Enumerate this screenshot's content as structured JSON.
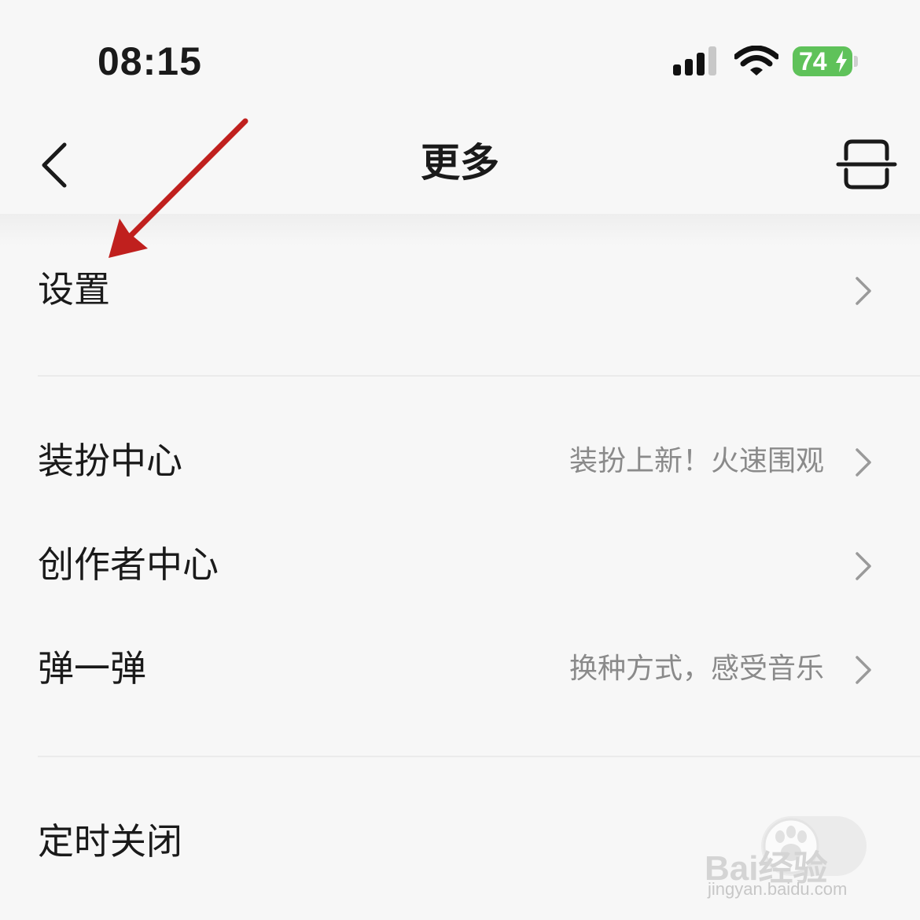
{
  "status_bar": {
    "time": "08:15",
    "battery_level": "74",
    "battery_color": "#5fc25a",
    "signal_icon": "cellular-signal-icon",
    "wifi_icon": "wifi-icon",
    "charging_icon": "bolt-icon"
  },
  "header": {
    "title": "更多",
    "back_icon": "chevron-left-icon",
    "scan_icon": "scan-icon"
  },
  "menu": {
    "settings": {
      "label": "设置"
    },
    "dress_center": {
      "label": "装扮中心",
      "subtitle": "装扮上新！火速围观"
    },
    "creator_center": {
      "label": "创作者中心"
    },
    "bounce": {
      "label": "弹一弹",
      "subtitle": "换种方式，感受音乐"
    },
    "sleep_timer": {
      "label": "定时关闭"
    }
  },
  "annotation": {
    "arrow_color": "#c0201e"
  },
  "watermark": {
    "brand": "Bai经验",
    "url": "jingyan.baidu.com"
  }
}
